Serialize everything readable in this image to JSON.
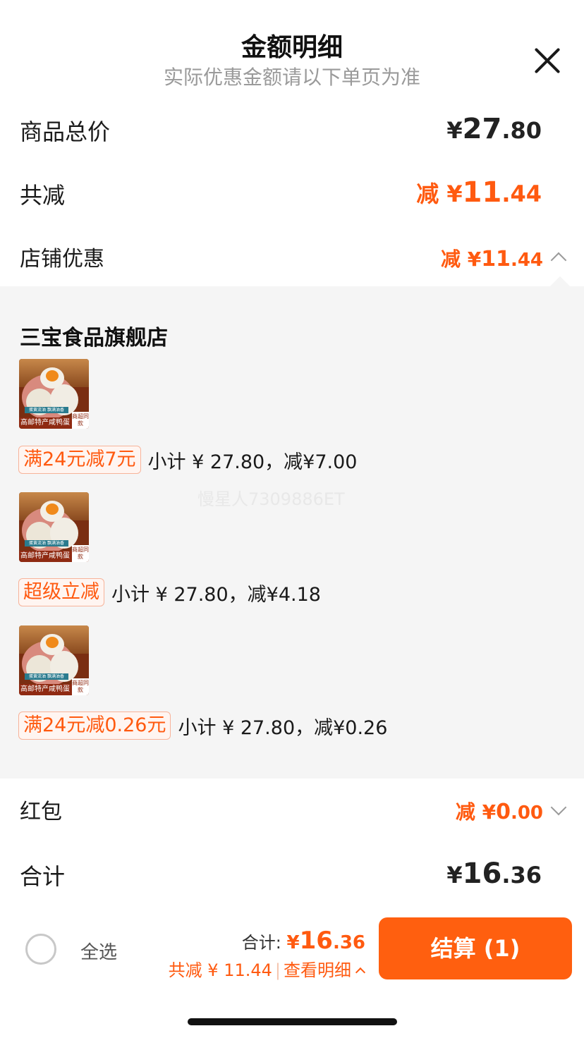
{
  "header": {
    "title": "金额明细",
    "subtitle": "实际优惠金额请以下单页为准"
  },
  "summary": {
    "goods_total_label": "商品总价",
    "goods_total_yen": "¥",
    "goods_total_int": "27",
    "goods_total_dec": ".80",
    "discount_label": "共减",
    "discount_prefix": "减 ¥",
    "discount_int": "11",
    "discount_dec": ".44",
    "store_discount_label": "店铺优惠",
    "store_discount_prefix": "减 ¥",
    "store_discount_int": "11",
    "store_discount_dec": ".44"
  },
  "store": {
    "name": "三宝食品旗舰店",
    "items": [
      {
        "product_banner": "高邮特产咸鸭蛋",
        "product_badge": "商超同款",
        "product_tagline": "蛋黄流油 飘满油香",
        "promo_tag": "满24元减7元",
        "promo_text": "小计 ¥ 27.80，减¥7.00"
      },
      {
        "product_banner": "高邮特产咸鸭蛋",
        "product_badge": "商超同款",
        "product_tagline": "蛋黄流油 飘满油香",
        "promo_tag": "超级立减",
        "promo_text": "小计 ¥ 27.80，减¥4.18"
      },
      {
        "product_banner": "高邮特产咸鸭蛋",
        "product_badge": "商超同款",
        "product_tagline": "蛋黄流油 飘满油香",
        "promo_tag": "满24元减0.26元",
        "promo_text": "小计 ¥ 27.80，减¥0.26"
      }
    ]
  },
  "watermark": "慢星人7309886ET",
  "red_packet": {
    "label": "红包",
    "prefix": "减 ¥",
    "int": "0",
    "dec": ".00"
  },
  "total": {
    "label": "合计",
    "yen": "¥",
    "int": "16",
    "dec": ".36"
  },
  "bottom_bar": {
    "select_all": "全选",
    "total_label": "合计: ",
    "total_yen": "¥",
    "total_int": "16",
    "total_dec": ".36",
    "saved_text": "共减 ¥ 11.44",
    "view_detail": "查看明细",
    "checkout_label": "结算 (1)"
  },
  "colors": {
    "accent": "#ff5a10",
    "button": "#ff5f0f",
    "panel_bg": "#f5f5f5"
  },
  "icons": [
    "close-icon",
    "chevron-up-icon",
    "chevron-down-icon",
    "checkbox-circle-icon"
  ]
}
